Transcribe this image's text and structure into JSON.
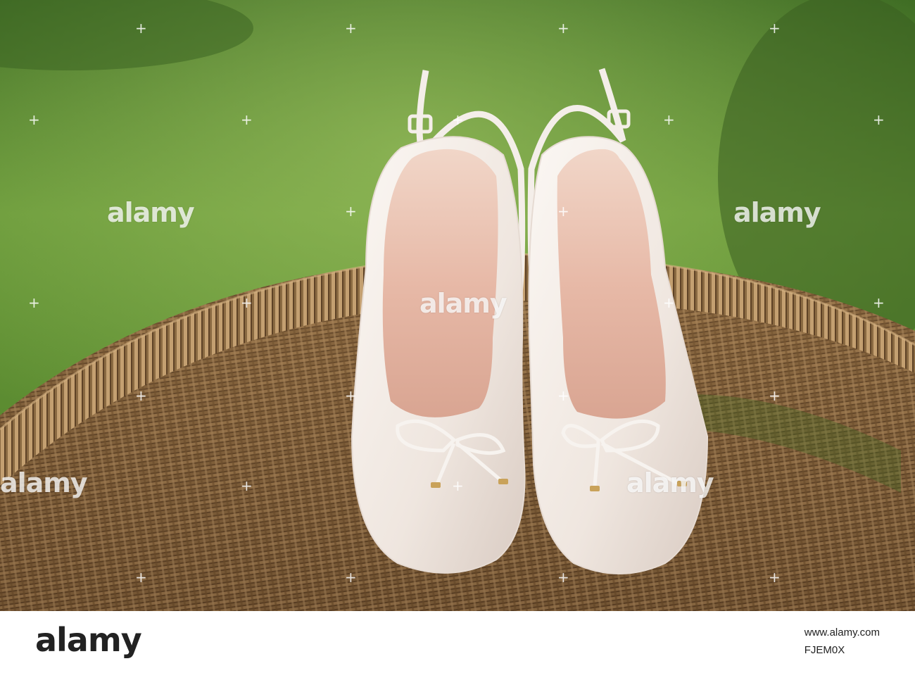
{
  "photo": {
    "subject": "pair of white slingback shoes with bows on wicker chair",
    "colors": {
      "grass": "#4a7f2c",
      "grass_light": "#79a74a",
      "wicker": "#7a5a36",
      "wicker_light": "#b89468",
      "shoe": "#f3ece6",
      "shoe_inner": "#e8c3b4",
      "accent_gold": "#c9a25a"
    }
  },
  "watermark": {
    "text": "alamy"
  },
  "footer": {
    "logo": "alamy",
    "url": "www.alamy.com",
    "image_id": "FJEM0X"
  }
}
